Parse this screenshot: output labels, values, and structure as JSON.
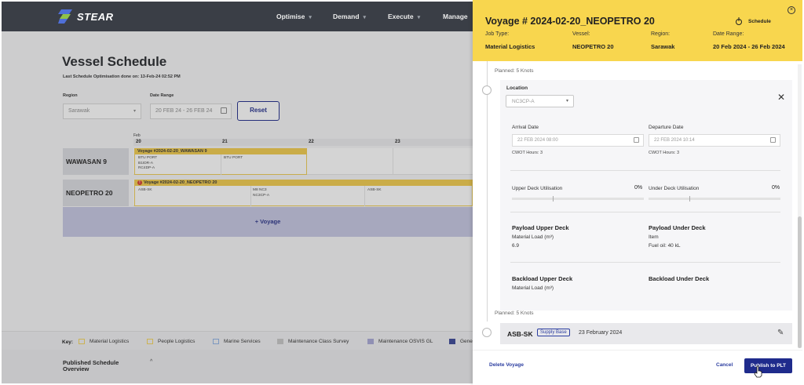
{
  "app": {
    "logo": "STEAR"
  },
  "nav": [
    {
      "label": "Optimise"
    },
    {
      "label": "Demand"
    },
    {
      "label": "Execute"
    },
    {
      "label": "Manage"
    }
  ],
  "page": {
    "title": "Vessel Schedule",
    "last_optimisation": "Last Schedule Optimisation done on: 13-Feb-24 02:52 PM",
    "region_label": "Region",
    "region_value": "Sarawak",
    "date_label": "Date Range",
    "date_value": "20 FEB 24 - 26 FEB 24",
    "reset_label": "Reset"
  },
  "timeline": {
    "month": "Feb",
    "days": [
      "20",
      "21",
      "22",
      "23"
    ],
    "rows": [
      {
        "vessel": "WAWASAN 9",
        "voyage": "Voyage #2024-02-20_WAWASAN 9",
        "stops_a": [
          "BTU PORT",
          "B1IDR-A",
          "RC4DP-A"
        ],
        "stops_b": [
          "BTU PORT"
        ]
      },
      {
        "vessel": "NEOPETRO 20",
        "voyage": "Voyage #2024-02-20_NEOPETRO 20",
        "stops_a": [
          "ASB-SK"
        ],
        "stops_b": [
          "M8 NC3",
          "NC3CP-A"
        ],
        "stops_c": [
          "ASB-SK"
        ]
      }
    ],
    "add_voyage": "+ Voyage"
  },
  "key": {
    "label": "Key:",
    "items": [
      {
        "label": "Material Logistics",
        "color": "#f5d55a"
      },
      {
        "label": "People Logistics",
        "color": "#f5d55a"
      },
      {
        "label": "Marine Services",
        "color": "#8fb3e6"
      },
      {
        "label": "Maintenance Class Survey",
        "color": "#c7c7c7"
      },
      {
        "label": "Maintenance OSVIS GL",
        "color": "#a8a8d6"
      },
      {
        "label": "Gene",
        "color": "#3a4798"
      }
    ]
  },
  "published": {
    "line1": "Published Schedule",
    "line2": "Overview"
  },
  "panel": {
    "title": "Voyage # 2024-02-20_NEOPETRO 20",
    "schedule_label": "Schedule",
    "fields": [
      {
        "label": "Job Type:",
        "value": "Material Logistics"
      },
      {
        "label": "Vessel:",
        "value": "NEOPETRO 20"
      },
      {
        "label": "Region:",
        "value": "Sarawak"
      },
      {
        "label": "Date Range:",
        "value": "20 Feb 2024 - 26 Feb 2024"
      }
    ],
    "planned_top": "Planned: 5 Knots",
    "location_label": "Location",
    "location_value": "NC3CP-A",
    "arrival_label": "Arrival Date",
    "arrival_value": "22 FEB 2024 08:00",
    "arrival_cwot": "CWOT Hours: 3",
    "departure_label": "Departure Date",
    "departure_value": "22 FEB 2024 10:14",
    "departure_cwot": "CWOT Hours: 3",
    "upper_util_label": "Upper Deck Utilisation",
    "upper_util_value": "0%",
    "under_util_label": "Under Deck Utilisation",
    "under_util_value": "0%",
    "payload_upper_title": "Payload Upper Deck",
    "payload_upper_sub": "Material Load (m³)",
    "payload_upper_val": "6.9",
    "payload_under_title": "Payload Under Deck",
    "payload_under_sub": "Item",
    "payload_under_val": "Fuel oil: 40 kL",
    "backload_upper_title": "Backload Upper Deck",
    "backload_upper_sub": "Material Load (m³)",
    "backload_under_title": "Backload Under Deck",
    "planned_bottom": "Planned: 5 Knots",
    "next_stop_name": "ASB-SK",
    "next_stop_badge": "Supply Base",
    "next_stop_date": "23 February 2024",
    "delete_label": "Delete Voyage",
    "cancel_label": "Cancel",
    "publish_label": "Publish to PLT"
  }
}
